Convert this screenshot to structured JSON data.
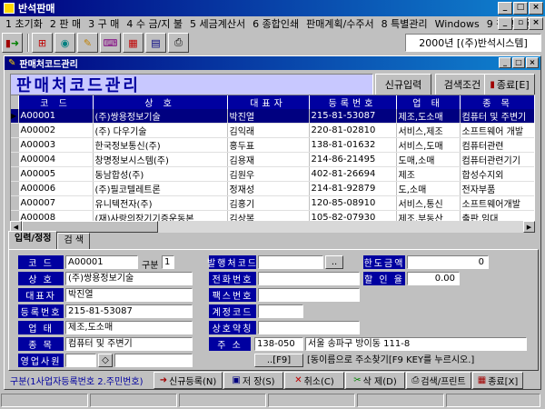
{
  "app": {
    "title": "반석판매"
  },
  "menu": [
    "1 초기화",
    "2 판 매",
    "3 구 매",
    "4 수 금/지 불",
    "5 세금계산서",
    "6 종합인쇄",
    "판매계획/수주서",
    "8 특별관리",
    "Windows",
    "9 창고이동"
  ],
  "company": "2000년  [(주)반석시스템]",
  "toolbar_icons": [
    "exit-door-icon",
    "network-icon",
    "globe-icon",
    "pencil-icon",
    "keyboard-icon",
    "grid-icon",
    "calculator-icon",
    "printer-icon"
  ],
  "child": {
    "title": "판매처코드관리",
    "heading": "판매처코드관리",
    "btn_new": "신규입력",
    "btn_search": "검색조건",
    "btn_close": "종료[E]"
  },
  "grid": {
    "columns": [
      "코 드",
      "상 호",
      "대표자",
      "등록번호",
      "업 태",
      "종 목"
    ],
    "rows": [
      [
        "A00001",
        "(주)쌍용정보기술",
        "박진열",
        "215-81-53087",
        "제조,도소매",
        "컴퓨터 및 주변기"
      ],
      [
        "A00002",
        "(주) 다우기술",
        "김익래",
        "220-81-02810",
        "서비스,제조",
        "소프트웨어 개발"
      ],
      [
        "A00003",
        "한국정보통신(주)",
        "홍두표",
        "138-81-01632",
        "서비스,도매",
        "컴퓨터관련"
      ],
      [
        "A00004",
        "창명정보시스템(주)",
        "김용재",
        "214-86-21495",
        "도매,소매",
        "컴퓨터관련기기"
      ],
      [
        "A00005",
        "동남합성(주)",
        "김원우",
        "402-81-26694",
        "제조",
        "합성수지외"
      ],
      [
        "A00006",
        "(주)필코텔레트론",
        "정재성",
        "214-81-92879",
        "도,소매",
        "전자부품"
      ],
      [
        "A00007",
        "유니텍전자(주)",
        "김홍기",
        "120-85-08910",
        "서비스,통신",
        "소프트웨어개발"
      ],
      [
        "A00008",
        "(재)사랑의장기기증운동본",
        "김상복",
        "105-82-07930",
        "제조,부동산",
        "출판,임대"
      ],
      [
        "A00009",
        "(주)오픈네트워크프라이즈",
        "조석기",
        "116-81-51725",
        "도매업,서비스",
        "네트워크축외"
      ]
    ]
  },
  "tabs": [
    "입력/정정",
    "검 색"
  ],
  "form": {
    "code_label": "코 드",
    "code": "A00001",
    "gubun_label": "구분",
    "gubun": "1",
    "name_label": "상 호",
    "name": "(주)쌍용정보기술",
    "ceo_label": "대표자",
    "ceo": "박진열",
    "regno_label": "등록번호",
    "regno": "215-81-53087",
    "biz_label": "업 태",
    "biz": "제조,도소매",
    "item_label": "종 목",
    "item": "컴퓨터 및 주변기",
    "sales_label": "영업사원",
    "issue_label": "발행처코드",
    "issue_btn": "..",
    "phone_label": "전화번호",
    "fax_label": "팩스번호",
    "acct_label": "계정코드",
    "alias_label": "상호약칭",
    "limit_label": "한도금액",
    "limit": "0",
    "discount_label": "할 인 율",
    "discount": "0.00",
    "addr_label": "주 소",
    "zip": "138-050",
    "addr": "서울 송파구 방이동 111-8",
    "f9_btn": "..[F9]",
    "f9_hint": "[동이름으로 주소찾기[F9 KEY를 누르시오.]"
  },
  "bottom": {
    "note": "구분(1사업자등록번호 2.주민번호)",
    "new": "신규등록(N)",
    "save": "저 장(S)",
    "cancel": "취소(C)",
    "delete": "삭 제(D)",
    "print": "검색/프린트",
    "exit": "종료[X]"
  }
}
